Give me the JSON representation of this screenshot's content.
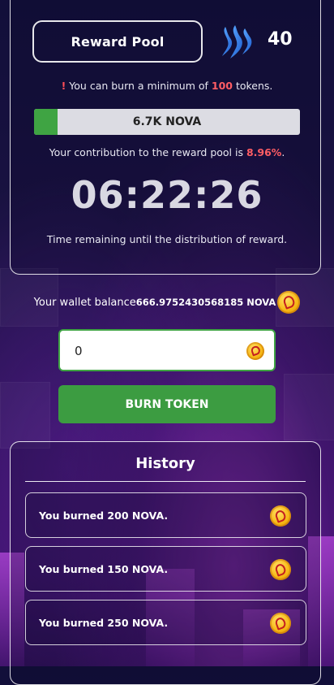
{
  "header": {
    "reward_pool_label": "Reward Pool",
    "count": "40",
    "icon": "steem-logo-icon"
  },
  "notice": {
    "bang": "!",
    "prefix": "You can burn a minimum of ",
    "minimum": "100",
    "suffix": " tokens."
  },
  "pool": {
    "label": "6.7K NOVA",
    "fill_percent": 8.96
  },
  "contribution": {
    "prefix": "Your contribution to the reward pool is ",
    "percent": "8.96%",
    "suffix": "."
  },
  "timer": {
    "value": "06:22:26",
    "caption": "Time remaining until the distribution of reward."
  },
  "wallet": {
    "label": "Your wallet balance",
    "amount": "666.9752430568185 NOVA"
  },
  "burn_input": {
    "value": "0"
  },
  "burn_button": {
    "label": "BURN TOKEN"
  },
  "history": {
    "title": "History",
    "items": [
      {
        "text": "You burned 200 NOVA."
      },
      {
        "text": "You burned 150 NOVA."
      },
      {
        "text": "You burned 250 NOVA."
      }
    ]
  },
  "colors": {
    "accent_green": "#3fa443",
    "highlight_red": "#ff5d64",
    "coin_gold": "#f7b916"
  }
}
